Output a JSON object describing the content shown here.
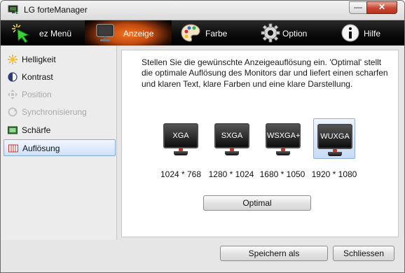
{
  "window": {
    "title": "LG forteManager",
    "minimize_label": "—",
    "close_label": "✕"
  },
  "menubar": {
    "items": [
      {
        "label": "ez Menü",
        "icon": "cursor-sparkle-icon"
      },
      {
        "label": "Anzeige",
        "icon": "monitor-icon",
        "active": true
      },
      {
        "label": "Farbe",
        "icon": "palette-icon"
      },
      {
        "label": "Option",
        "icon": "gear-icon"
      },
      {
        "label": "Hilfe",
        "icon": "info-icon"
      }
    ],
    "active_color": "#f5731f"
  },
  "sidebar": {
    "items": [
      {
        "label": "Helligkeit",
        "icon": "sun-icon",
        "enabled": true
      },
      {
        "label": "Kontrast",
        "icon": "contrast-icon",
        "enabled": true
      },
      {
        "label": "Position",
        "icon": "position-icon",
        "enabled": false
      },
      {
        "label": "Synchronisierung",
        "icon": "sync-icon",
        "enabled": false
      },
      {
        "label": "Schärfe",
        "icon": "sharpness-icon",
        "enabled": true
      },
      {
        "label": "Auflösung",
        "icon": "resolution-icon",
        "enabled": true,
        "selected": true
      }
    ]
  },
  "main": {
    "description": "Stellen Sie die gewünschte Anzeigeauflösung ein. 'Optimal' stellt die optimale Auflösung des Monitors dar und liefert einen scharfen und klaren Text, klare Farben und eine klare Darstellung.",
    "resolutions": [
      {
        "name": "XGA",
        "value": "1024 * 768"
      },
      {
        "name": "SXGA",
        "value": "1280 * 1024"
      },
      {
        "name": "WSXGA+",
        "value": "1680 * 1050"
      },
      {
        "name": "WUXGA",
        "value": "1920 * 1080",
        "selected": true
      }
    ],
    "optimal_label": "Optimal"
  },
  "footer": {
    "save_as_label": "Speichern als",
    "close_label": "Schliessen"
  }
}
